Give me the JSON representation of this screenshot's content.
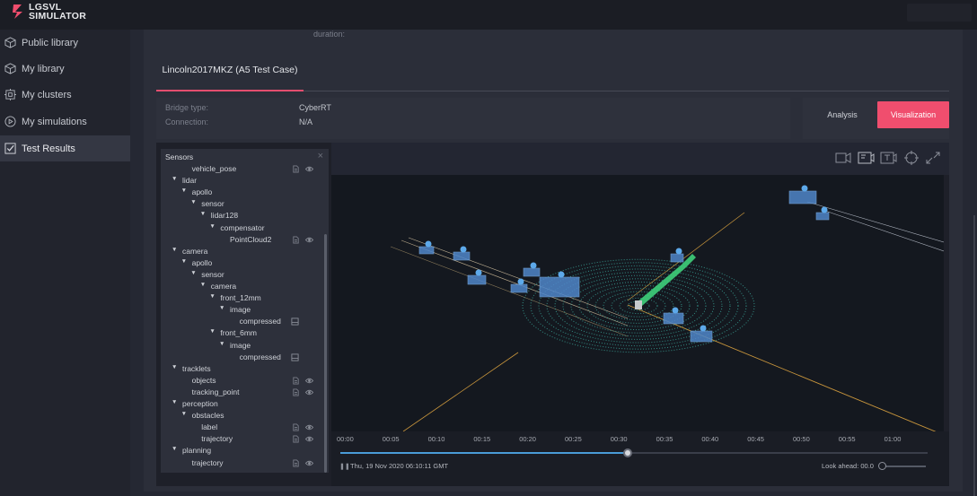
{
  "app": {
    "logo_line1": "LGSVL",
    "logo_line2": "SIMULATOR"
  },
  "sidebar": {
    "items": [
      {
        "label": "Public library",
        "icon": "cube-icon",
        "active": false
      },
      {
        "label": "My library",
        "icon": "cube-outline-icon",
        "active": false
      },
      {
        "label": "My clusters",
        "icon": "cluster-icon",
        "active": false
      },
      {
        "label": "My simulations",
        "icon": "play-circle-icon",
        "active": false
      },
      {
        "label": "Test Results",
        "icon": "checklist-icon",
        "active": true
      }
    ]
  },
  "main": {
    "duration_label": "duration:",
    "tab_label": "Lincoln2017MKZ (A5 Test Case)",
    "bridge_type_label": "Bridge type:",
    "bridge_type_value": "CyberRT",
    "connection_label": "Connection:",
    "connection_value": "N/A",
    "analysis_button": "Analysis",
    "visualization_button": "Visualization"
  },
  "sensors": {
    "title": "Sensors",
    "tree": [
      {
        "label": "vehicle_pose",
        "depth": 1,
        "arrow": false,
        "icons": true
      },
      {
        "label": "lidar",
        "depth": 0,
        "arrow": true,
        "icons": false
      },
      {
        "label": "apollo",
        "depth": 1,
        "arrow": true,
        "icons": false
      },
      {
        "label": "sensor",
        "depth": 2,
        "arrow": true,
        "icons": false
      },
      {
        "label": "lidar128",
        "depth": 3,
        "arrow": true,
        "icons": false
      },
      {
        "label": "compensator",
        "depth": 4,
        "arrow": true,
        "icons": false
      },
      {
        "label": "PointCloud2",
        "depth": 5,
        "arrow": false,
        "icons": true
      },
      {
        "label": "camera",
        "depth": 0,
        "arrow": true,
        "icons": false
      },
      {
        "label": "apollo",
        "depth": 1,
        "arrow": true,
        "icons": false
      },
      {
        "label": "sensor",
        "depth": 2,
        "arrow": true,
        "icons": false
      },
      {
        "label": "camera",
        "depth": 3,
        "arrow": true,
        "icons": false
      },
      {
        "label": "front_12mm",
        "depth": 4,
        "arrow": true,
        "icons": false
      },
      {
        "label": "image",
        "depth": 5,
        "arrow": true,
        "icons": false
      },
      {
        "label": "compressed",
        "depth": 6,
        "arrow": false,
        "icons": "image"
      },
      {
        "label": "front_6mm",
        "depth": 4,
        "arrow": true,
        "icons": false
      },
      {
        "label": "image",
        "depth": 5,
        "arrow": true,
        "icons": false
      },
      {
        "label": "compressed",
        "depth": 6,
        "arrow": false,
        "icons": "image"
      },
      {
        "label": "tracklets",
        "depth": 0,
        "arrow": true,
        "icons": false
      },
      {
        "label": "objects",
        "depth": 1,
        "arrow": false,
        "icons": true
      },
      {
        "label": "tracking_point",
        "depth": 1,
        "arrow": false,
        "icons": true
      },
      {
        "label": "perception",
        "depth": 0,
        "arrow": true,
        "icons": false
      },
      {
        "label": "obstacles",
        "depth": 1,
        "arrow": true,
        "icons": false
      },
      {
        "label": "label",
        "depth": 2,
        "arrow": false,
        "icons": true
      },
      {
        "label": "trajectory",
        "depth": 2,
        "arrow": false,
        "icons": true
      },
      {
        "label": "planning",
        "depth": 0,
        "arrow": true,
        "icons": false
      },
      {
        "label": "trajectory",
        "depth": 1,
        "arrow": false,
        "icons": true
      }
    ]
  },
  "toolbar": {
    "icons": [
      "video-record-icon",
      "frame-icon",
      "text-overlay-icon",
      "crosshair-icon",
      "expand-icon"
    ]
  },
  "timeline": {
    "ticks": [
      "00:00",
      "00:05",
      "00:10",
      "00:15",
      "00:20",
      "00:25",
      "00:30",
      "00:35",
      "00:40",
      "00:45",
      "00:50",
      "00:55",
      "01:00"
    ],
    "progress_fraction": 0.49,
    "timestamp": "Thu, 19 Nov 2020 06:10:11 GMT",
    "look_ahead": "Look ahead: 00.0",
    "pause_icon": "pause-icon"
  },
  "colors": {
    "accent": "#f04e6e",
    "track_fill": "#4a9cd8",
    "path": "#3ecf7a",
    "point_cloud": "#3fb6a8"
  }
}
